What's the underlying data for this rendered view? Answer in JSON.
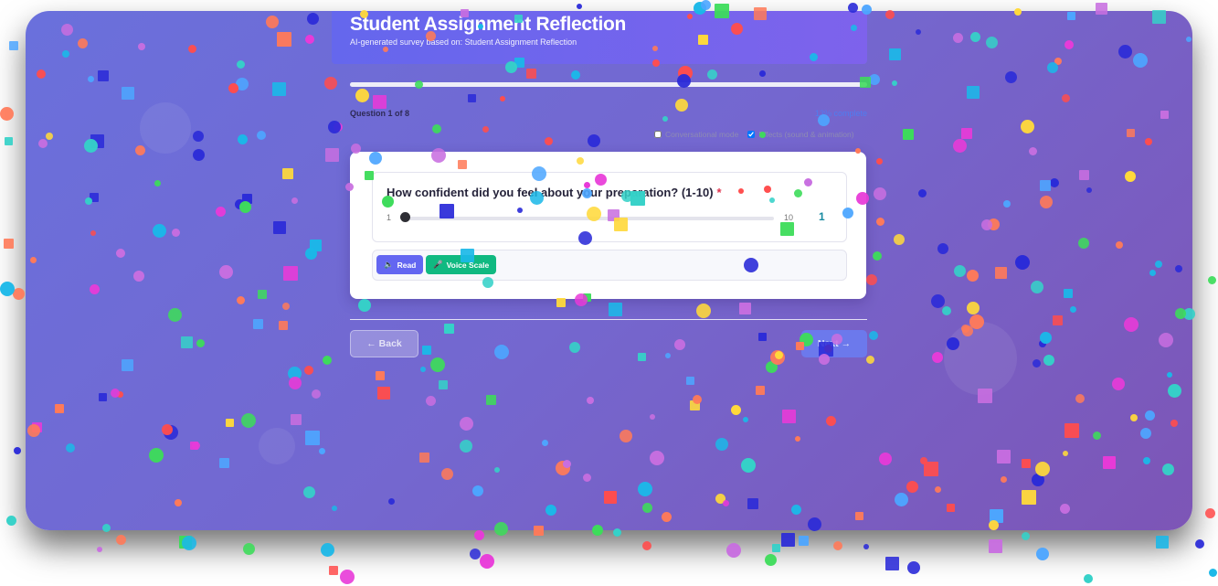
{
  "header": {
    "title": "Student Assignment Reflection",
    "subtitle": "AI-generated survey based on: Student Assignment Reflection"
  },
  "progress": {
    "counter": "Question 1 of 8",
    "percent_label": "13% complete",
    "fraction": 1.0
  },
  "options": {
    "conversational_label": "Conversational mode",
    "conversational_checked": false,
    "effects_label": "Effects (sound & animation)",
    "effects_checked": true
  },
  "question": {
    "text": "How confident did you feel about your preparation? (1-10)",
    "required_marker": "*",
    "slider": {
      "min": 1,
      "max": 10,
      "value": 1
    }
  },
  "actions": {
    "read_label": "Read",
    "read_icon": "speaker-icon",
    "voice_scale_label": "Voice Scale",
    "voice_scale_icon": "microphone-icon"
  },
  "nav": {
    "back_label": "Back",
    "back_icon": "arrow-left-icon",
    "next_label": "Next",
    "next_icon": "arrow-right-icon"
  },
  "colors": {
    "accent": "#6366f1",
    "voice_green": "#10b981",
    "value_teal": "#178aa0",
    "required_red": "#e0334d",
    "confetti": [
      "#ff4d4d",
      "#ffd93b",
      "#4da6ff",
      "#3ddc5a",
      "#c86ee0",
      "#ff7a59",
      "#1bb8e8",
      "#2a2ad8",
      "#e83ad8",
      "#35d1c8"
    ]
  }
}
